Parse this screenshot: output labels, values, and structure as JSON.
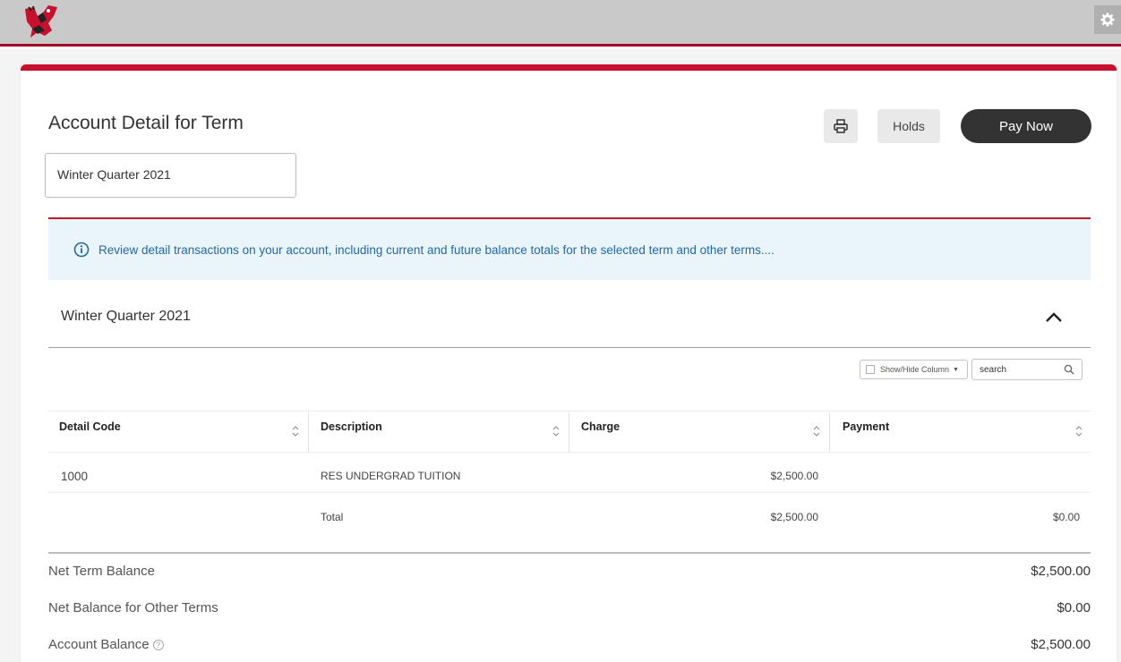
{
  "header": {
    "logo_icon": "eagle-logo-icon",
    "settings_icon": "gear-icon",
    "accent_color": "#a10022"
  },
  "page": {
    "title": "Account Detail for Term",
    "selected_term": "Winter Quarter 2021"
  },
  "actions": {
    "print_icon": "printer-icon",
    "holds_label": "Holds",
    "pay_label": "Pay Now"
  },
  "info": {
    "icon": "info-icon",
    "text": "Review detail transactions on your account, including current and future balance totals for the selected term and other terms...."
  },
  "term_section": {
    "title": "Winter Quarter 2021",
    "collapse_icon": "chevron-up-icon",
    "toolbar": {
      "show_hide_label": "Show/Hide Column",
      "search_value": "search"
    },
    "columns": [
      "Detail Code",
      "Description",
      "Charge",
      "Payment"
    ],
    "rows": [
      {
        "detail_code": "1000",
        "description": "RES UNDERGRAD TUITION",
        "charge": "$2,500.00",
        "payment": ""
      }
    ],
    "total": {
      "label": "Total",
      "charge": "$2,500.00",
      "payment": "$0.00"
    }
  },
  "summary": {
    "net_term_balance_label": "Net Term Balance",
    "net_term_balance": "$2,500.00",
    "other_terms_label": "Net Balance for Other Terms",
    "other_terms": "$0.00",
    "account_balance_label": "Account Balance",
    "account_balance": "$2,500.00"
  }
}
